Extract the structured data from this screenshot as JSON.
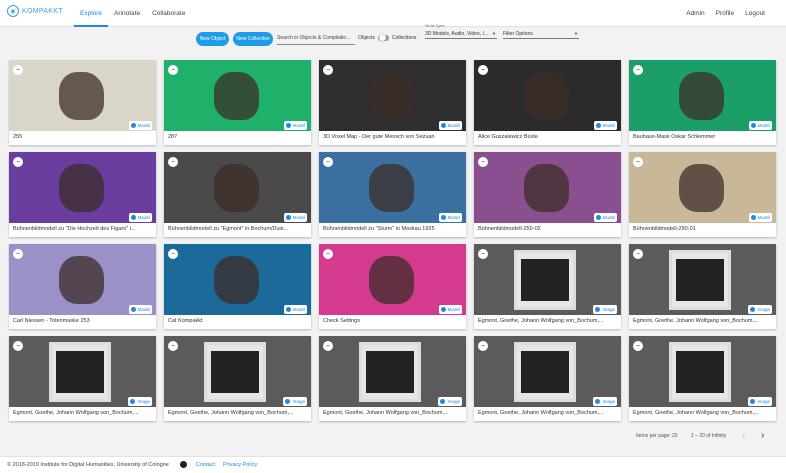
{
  "app": {
    "logo_text": "KOMPAKKT"
  },
  "nav": {
    "items": [
      "Explore",
      "Annotate",
      "Collaborate"
    ]
  },
  "user": {
    "links": [
      "Admin",
      "Profile",
      "Logout"
    ]
  },
  "toolbar": {
    "new_object": "New Object",
    "new_collection": "New Collection",
    "search_placeholder": "Search in Objects & Compilatio...",
    "toggle_left": "Objects",
    "toggle_right": "Collections",
    "media_label": "Media Types",
    "media_value": "3D Models, Audio, Video, I...",
    "filter_value": "Filter Options"
  },
  "cards": [
    {
      "title": "255",
      "type": "Model",
      "bg": "#d9d6c9"
    },
    {
      "title": "287",
      "type": "Model",
      "bg": "#1fb06a"
    },
    {
      "title": "3D Voxel Map - Der gute Mensch von Sezuan",
      "type": "Model",
      "bg": "#2f2f2f"
    },
    {
      "title": "Alice Guszalewicz Büste",
      "type": "Model",
      "bg": "#2b2b2b"
    },
    {
      "title": "Bauhaus-Mask Oskar Schlemmer",
      "type": "Model",
      "bg": "#1c9e68"
    },
    {
      "title": "Bühnenbildmodell zu \"Die Hochzeit des Figaro\" i...",
      "type": "Model",
      "bg": "#6a3e9e"
    },
    {
      "title": "Bühnenbildmodell zu \"Egmont\" in Bochum/Duis...",
      "type": "Model",
      "bg": "#4a4a4a"
    },
    {
      "title": "Bühnenbildmodell zu \"Sturm\" in Moskau 1925",
      "type": "Model",
      "bg": "#3b6fa0"
    },
    {
      "title": "Bühnenbildmodell-250-02",
      "type": "Model",
      "bg": "#8a4f8e"
    },
    {
      "title": "Bühnenbildmodell-250-01",
      "type": "Model",
      "bg": "#c9b79a"
    },
    {
      "title": "Carl Niessen - Totenmaske 253",
      "type": "Model",
      "bg": "#9c90c9"
    },
    {
      "title": "Cat Kompakkt",
      "type": "Model",
      "bg": "#1b6a9a"
    },
    {
      "title": "Check Settings",
      "type": "Model",
      "bg": "#d43a8e"
    },
    {
      "title": "Egmont, Goethe, Johann Wolfgang von_Bochum,...",
      "type": "Image",
      "bg": "#5b5b5b"
    },
    {
      "title": "Egmont, Goethe, Johann Wolfgang von_Bochum,...",
      "type": "Image",
      "bg": "#5b5b5b"
    },
    {
      "title": "Egmont, Goethe, Johann Wolfgang von_Bochum,...",
      "type": "Image",
      "bg": "#5b5b5b"
    },
    {
      "title": "Egmont, Goethe, Johann Wolfgang von_Bochum,...",
      "type": "Image",
      "bg": "#5b5b5b"
    },
    {
      "title": "Egmont, Goethe, Johann Wolfgang von_Bochum,...",
      "type": "Image",
      "bg": "#5b5b5b"
    },
    {
      "title": "Egmont, Goethe, Johann Wolfgang von_Bochum,...",
      "type": "Image",
      "bg": "#5b5b5b"
    },
    {
      "title": "Egmont, Goethe, Johann Wolfgang von_Bochum,...",
      "type": "Image",
      "bg": "#5b5b5b"
    }
  ],
  "pager": {
    "items_per_page_label": "Items per page:",
    "items_per_page": "20",
    "range": "1 – 20 of Infinity"
  },
  "footer": {
    "copyright": "© 2018-2019 Institute for Digital Humanities, University of Cologne",
    "contact": "Contact",
    "privacy": "Privacy Policy"
  },
  "colors": {
    "accent": "#1e88e5"
  }
}
